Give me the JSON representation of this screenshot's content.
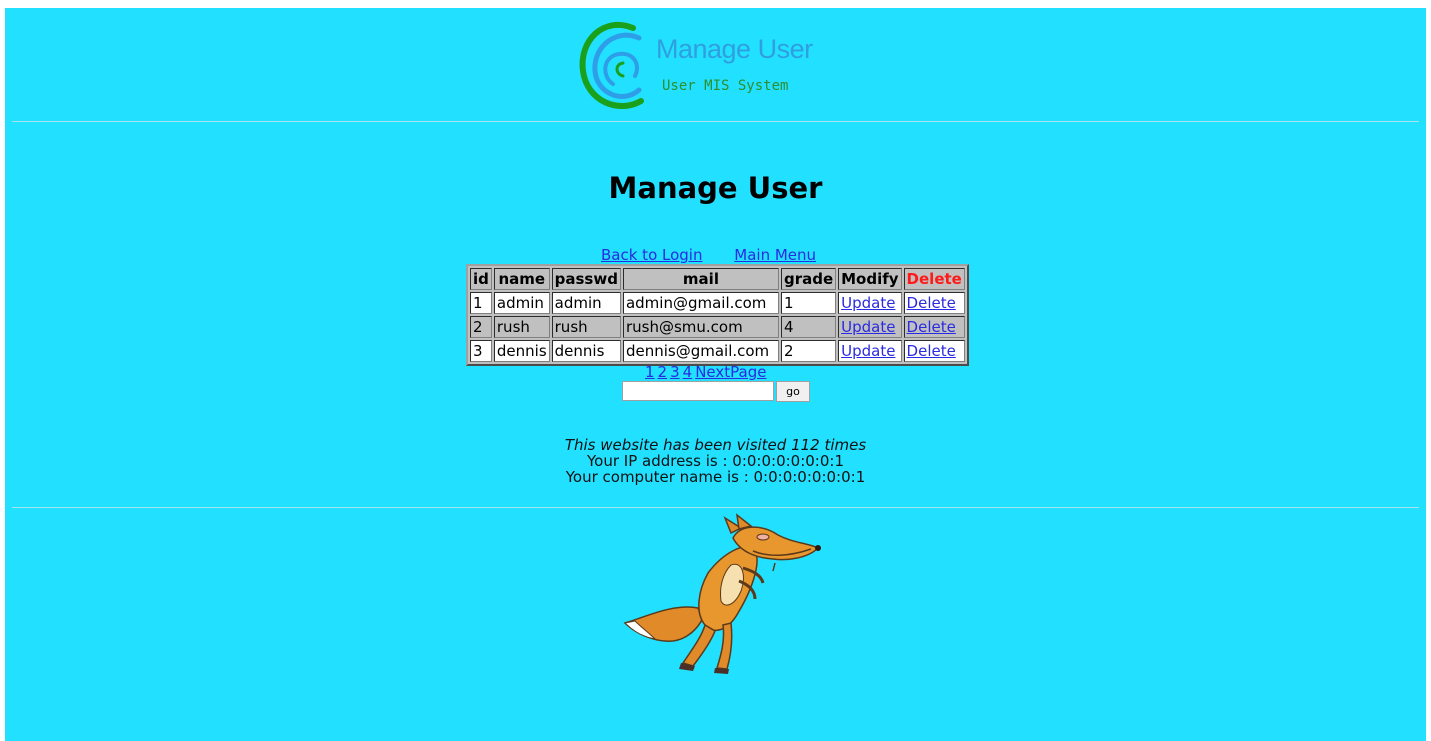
{
  "logo": {
    "title": "Manage User",
    "subtitle": "User MIS System"
  },
  "page_title": "Manage User",
  "nav": {
    "back_to_login": "Back to Login",
    "main_menu": "Main Menu"
  },
  "table": {
    "headers": [
      "id",
      "name",
      "passwd",
      "mail",
      "grade",
      "Modify",
      "Delete"
    ],
    "rows": [
      {
        "id": "1",
        "name": "admin",
        "passwd": "admin",
        "mail": "admin@gmail.com",
        "grade": "1",
        "modify": "Update",
        "delete": "Delete"
      },
      {
        "id": "2",
        "name": "rush",
        "passwd": "rush",
        "mail": "rush@smu.com",
        "grade": "4",
        "modify": "Update",
        "delete": "Delete"
      },
      {
        "id": "3",
        "name": "dennis",
        "passwd": "dennis",
        "mail": "dennis@gmail.com",
        "grade": "2",
        "modify": "Update",
        "delete": "Delete"
      }
    ]
  },
  "pager": {
    "pages": [
      "1",
      "2",
      "3",
      "4"
    ],
    "next": "NextPage",
    "go_input_value": "",
    "go_label": "go"
  },
  "info": {
    "visits": "This website has been visited 112 times",
    "ip": "Your IP address is : 0:0:0:0:0:0:0:1",
    "computer": "Your computer name is : 0:0:0:0:0:0:0:1"
  },
  "colors": {
    "background": "#22e0ff",
    "link": "#2a2ae0",
    "delete_header": "#ff1a1a",
    "logo_title": "#2f9fe0",
    "logo_subtitle": "#2d8f2d"
  },
  "icons": {
    "logo": "swirl-logo-icon",
    "mascot": "fox-illustration"
  }
}
